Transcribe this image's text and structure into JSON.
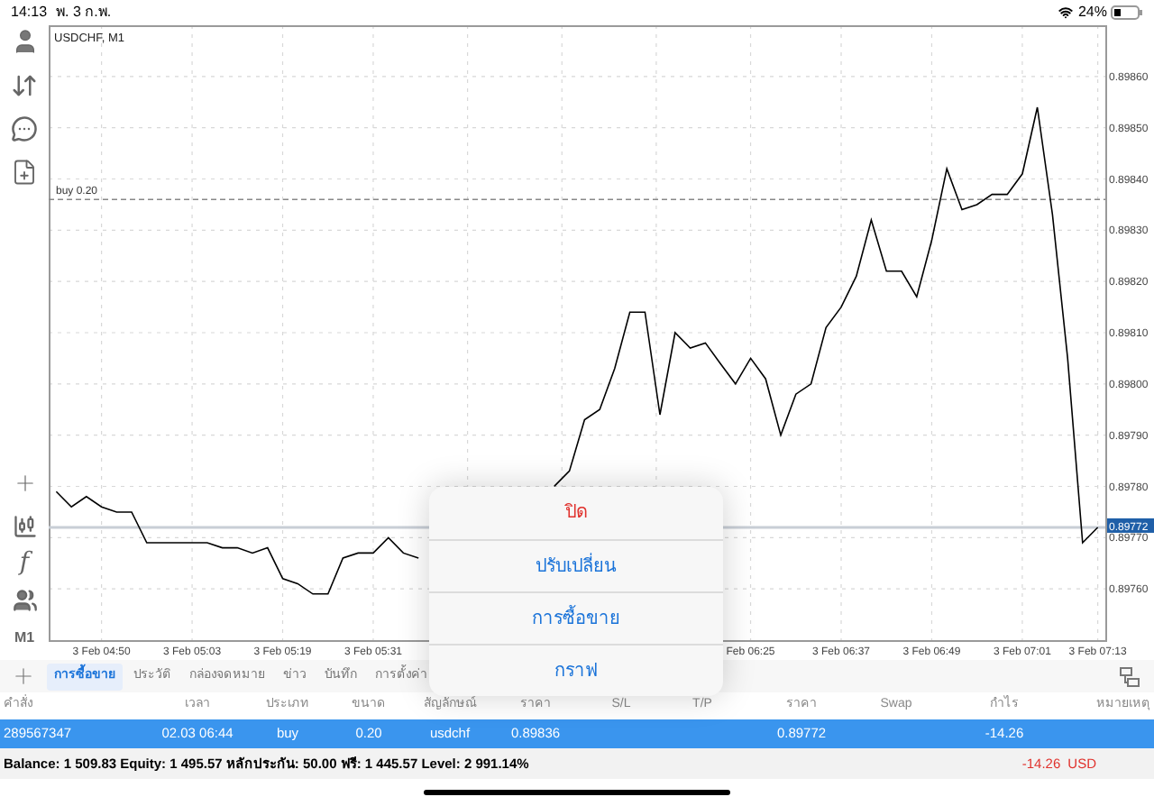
{
  "status_bar": {
    "time": "14:13",
    "date": "พ. 3 ก.พ.",
    "battery": "24%"
  },
  "toolbar": {
    "indicator_button": "f",
    "timeframe": "M1"
  },
  "chart": {
    "chart_data": {
      "type": "line",
      "title": "USDCHF, M1",
      "categories": [
        null,
        null,
        null,
        "3 Feb 04:50",
        null,
        null,
        null,
        null,
        null,
        "3 Feb 05:03",
        null,
        null,
        null,
        null,
        null,
        "3 Feb 05:19",
        null,
        null,
        null,
        null,
        null,
        "3 Feb 05:31",
        null,
        null,
        null,
        null,
        null,
        null,
        null,
        null,
        null,
        null,
        null,
        null,
        null,
        null,
        null,
        null,
        null,
        null,
        null,
        null,
        null,
        null,
        null,
        null,
        "Feb 06:25",
        null,
        null,
        null,
        null,
        null,
        "3 Feb 06:37",
        null,
        null,
        null,
        null,
        null,
        "3 Feb 06:49",
        null,
        null,
        null,
        null,
        null,
        "3 Feb 07:01",
        null,
        null,
        null,
        null,
        "3 Feb 07:13"
      ],
      "series": [
        {
          "color": "#000000",
          "values": [
            0.89779,
            0.89776,
            0.89778,
            0.89776,
            0.89775,
            0.89775,
            0.89769,
            0.89769,
            0.89769,
            0.89769,
            0.89769,
            0.89768,
            0.89768,
            0.89767,
            0.89768,
            0.89762,
            0.89761,
            0.89759,
            0.89759,
            0.89766,
            0.89767,
            0.89767,
            0.8977,
            0.89767,
            0.89766,
            null,
            null,
            null,
            null,
            null,
            null,
            null,
            null,
            0.8978,
            0.89783,
            0.89793,
            0.89795,
            0.89803,
            0.89814,
            0.89814,
            0.89794,
            0.8981,
            0.89807,
            0.89808,
            0.89804,
            0.898,
            0.89805,
            0.89801,
            0.8979,
            0.89798,
            0.898,
            0.89811,
            0.89815,
            0.89821,
            0.89832,
            0.89822,
            0.89822,
            0.89817,
            0.89828,
            0.89842,
            0.89834,
            0.89835,
            0.89837,
            0.89837,
            0.89841,
            0.89854,
            0.89833,
            0.89805,
            0.89769,
            0.89772
          ]
        }
      ],
      "ylim": [
        0.8975,
        0.8987
      ],
      "grid": true,
      "ref_lines": [
        {
          "axis": "y",
          "value": 0.89836,
          "label": "buy 0.20"
        },
        {
          "axis": "y",
          "value": 0.89772,
          "label": "0.89772"
        }
      ],
      "yticks": [
        {
          "value": 0.8976,
          "label": "0.89760"
        },
        {
          "value": 0.8977,
          "label": "0.89770"
        },
        {
          "value": 0.8978,
          "label": "0.89780"
        },
        {
          "value": 0.8979,
          "label": "0.89790"
        },
        {
          "value": 0.898,
          "label": "0.89800"
        },
        {
          "value": 0.8981,
          "label": "0.89810"
        },
        {
          "value": 0.8982,
          "label": "0.89820"
        },
        {
          "value": 0.8983,
          "label": "0.89830"
        },
        {
          "value": 0.8984,
          "label": "0.89840"
        },
        {
          "value": 0.8985,
          "label": "0.89850"
        },
        {
          "value": 0.8986,
          "label": "0.89860"
        }
      ]
    }
  },
  "tabs": [
    {
      "label": "การซื้อขาย",
      "selected": true
    },
    {
      "label": "ประวัติ",
      "selected": false
    },
    {
      "label": "กล่องจดหมาย",
      "selected": false
    },
    {
      "label": "ข่าว",
      "selected": false
    },
    {
      "label": "บันทึก",
      "selected": false
    },
    {
      "label": "การตั้งค่า",
      "selected": false
    }
  ],
  "table": {
    "columns": [
      "คำสั่ง",
      "เวลา",
      "ประเภท",
      "ขนาด",
      "สัญลักษณ์",
      "ราคา",
      "S/L",
      "T/P",
      "ราคา",
      "Swap",
      "กำไร",
      "หมายเหตุ"
    ],
    "rows": [
      {
        "selected": true,
        "cells": [
          "289567347",
          "02.03 06:44",
          "buy",
          "0.20",
          "usdchf",
          "0.89836",
          "",
          "",
          "0.89772",
          "",
          "-14.26",
          ""
        ]
      }
    ]
  },
  "summary": {
    "text": "Balance: 1 509.83 Equity: 1 495.57 หลักประกัน: 50.00 ฟรี: 1 445.57 Level: 2 991.14%",
    "profit": "-14.26",
    "currency": "USD"
  },
  "menu": [
    {
      "label": "ปิด",
      "kind": "destructive"
    },
    {
      "label": "ปรับเปลี่ยน",
      "kind": "default"
    },
    {
      "label": "การซื้อขาย",
      "kind": "default"
    },
    {
      "label": "กราฟ",
      "kind": "default"
    }
  ]
}
